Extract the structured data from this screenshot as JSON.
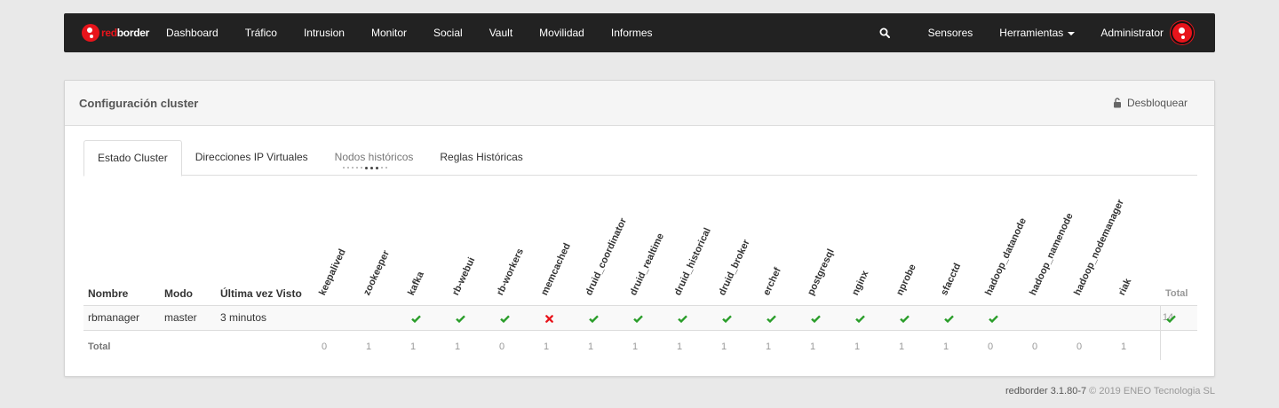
{
  "navbar": {
    "brand_red": "red",
    "brand_white": "border",
    "items": [
      "Dashboard",
      "Tráfico",
      "Intrusion",
      "Monitor",
      "Social",
      "Vault",
      "Movilidad",
      "Informes"
    ],
    "sensors": "Sensores",
    "tools": "Herramientas",
    "user": "Administrator"
  },
  "panel": {
    "title": "Configuración cluster",
    "unlock": "Desbloquear"
  },
  "tabs": [
    "Estado Cluster",
    "Direcciones IP Virtuales",
    "Nodos históricos",
    "Reglas Históricas"
  ],
  "table": {
    "headers": {
      "name": "Nombre",
      "mode": "Modo",
      "last_seen": "Última vez Visto",
      "total": "Total"
    },
    "services": [
      "keepalived",
      "zookeeper",
      "kafka",
      "rb-webui",
      "rb-workers",
      "memcached",
      "druid_coordinator",
      "druid_realtime",
      "druid_historical",
      "druid_broker",
      "erchef",
      "postgresql",
      "nginx",
      "nprobe",
      "sfacctd",
      "hadoop_datanode",
      "hadoop_namenode",
      "hadoop_nodemanager",
      "riak"
    ],
    "row": {
      "name": "rbmanager",
      "mode": "master",
      "last_seen": "3 minutos",
      "status": [
        "none",
        "ok",
        "ok",
        "ok",
        "fail",
        "ok",
        "ok",
        "ok",
        "ok",
        "ok",
        "ok",
        "ok",
        "ok",
        "ok",
        "ok",
        "none",
        "none",
        "none",
        "ok"
      ],
      "total": "14"
    },
    "totals_label": "Total",
    "totals": [
      "0",
      "1",
      "1",
      "1",
      "0",
      "1",
      "1",
      "1",
      "1",
      "1",
      "1",
      "1",
      "1",
      "1",
      "1",
      "0",
      "0",
      "0",
      "1"
    ]
  },
  "colors": {
    "ok": "#2a9d2a",
    "fail": "#e8141b",
    "brand": "#e8141b"
  },
  "footer": {
    "product": "redborder 3.1.80-7",
    "copyright": "© 2019 ENEO Tecnologia SL"
  }
}
